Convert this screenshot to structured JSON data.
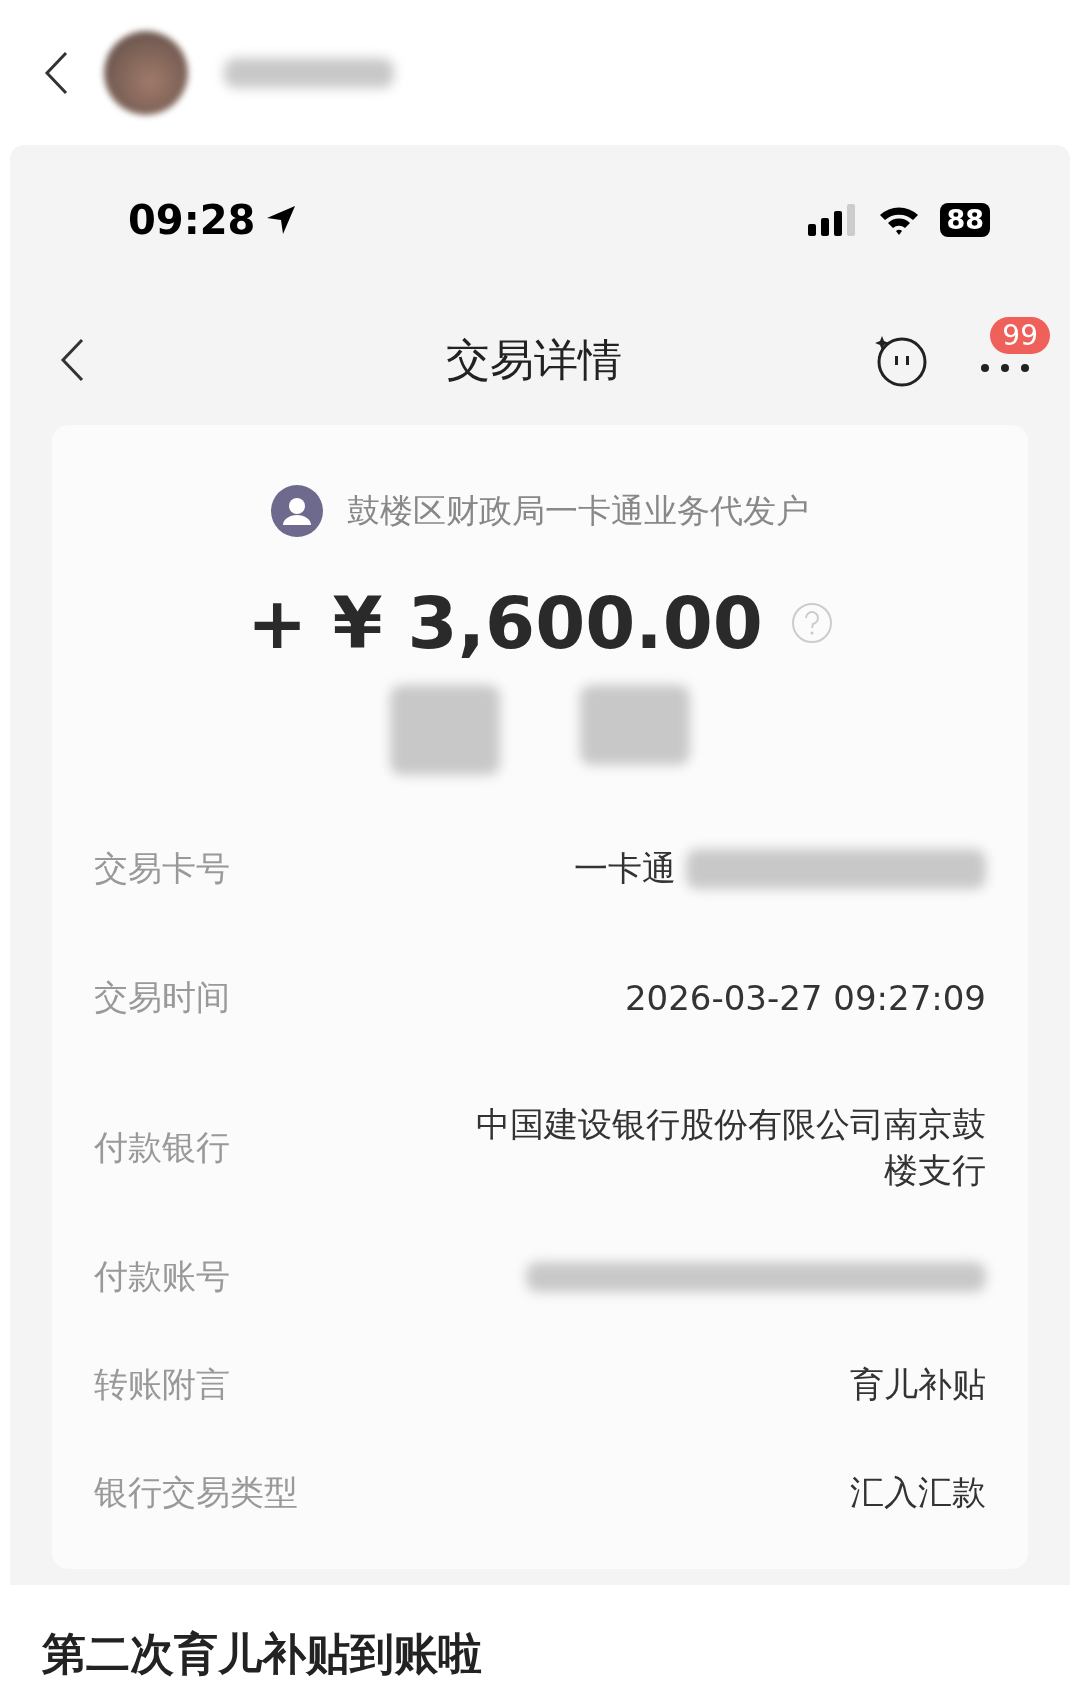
{
  "post_header": {
    "author": {
      "kind": "redacted"
    }
  },
  "phone_status_bar": {
    "time": "09:28",
    "battery": "88"
  },
  "nav_bar": {
    "title": "交易详情",
    "badge": "99"
  },
  "transaction": {
    "payer": "鼓楼区财政局一卡通业务代发户",
    "amount": "+ ¥ 3,600.00",
    "note": {
      "kind": "redacted"
    }
  },
  "details": [
    {
      "label": "交易卡号",
      "kind": "text_redacted",
      "value": "一卡通"
    },
    {
      "label": "交易时间",
      "kind": "text",
      "value": "2026-03-27 09:27:09"
    },
    {
      "label": "付款银行",
      "kind": "text",
      "value": "中国建设银行股份有限公司南京鼓楼支行"
    },
    {
      "label": "付款账号",
      "kind": "redacted"
    },
    {
      "label": "转账附言",
      "kind": "text",
      "value": "育儿补贴"
    },
    {
      "label": "银行交易类型",
      "kind": "text",
      "value": "汇入汇款"
    }
  ],
  "post_title": "第二次育儿补贴到账啦"
}
